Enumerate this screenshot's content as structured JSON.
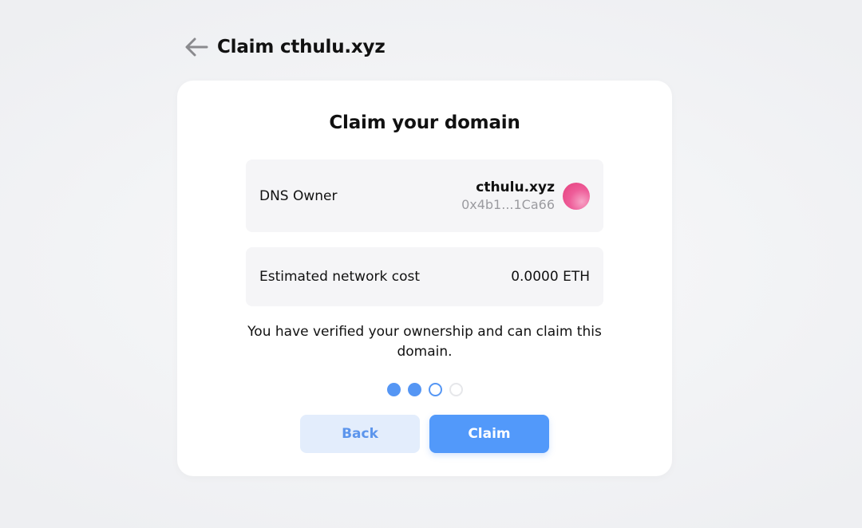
{
  "header": {
    "title": "Claim cthulu.xyz",
    "back_icon": "arrow-left-icon"
  },
  "card": {
    "title": "Claim your domain",
    "owner_row": {
      "label": "DNS Owner",
      "name": "cthulu.xyz",
      "address": "0x4b1...1Ca66",
      "avatar_icon": "avatar-gradient"
    },
    "cost_row": {
      "label": "Estimated network cost",
      "value": "0.0000 ETH"
    },
    "message": "You have verified your ownership and can claim this domain.",
    "steps": {
      "total": 4,
      "completed": 2,
      "current": 3
    },
    "buttons": {
      "back_label": "Back",
      "claim_label": "Claim"
    }
  },
  "colors": {
    "accent": "#5299fa",
    "back_button_bg": "#e3edfc",
    "row_bg": "#f5f5f7",
    "muted_text": "#9b9ba0"
  }
}
